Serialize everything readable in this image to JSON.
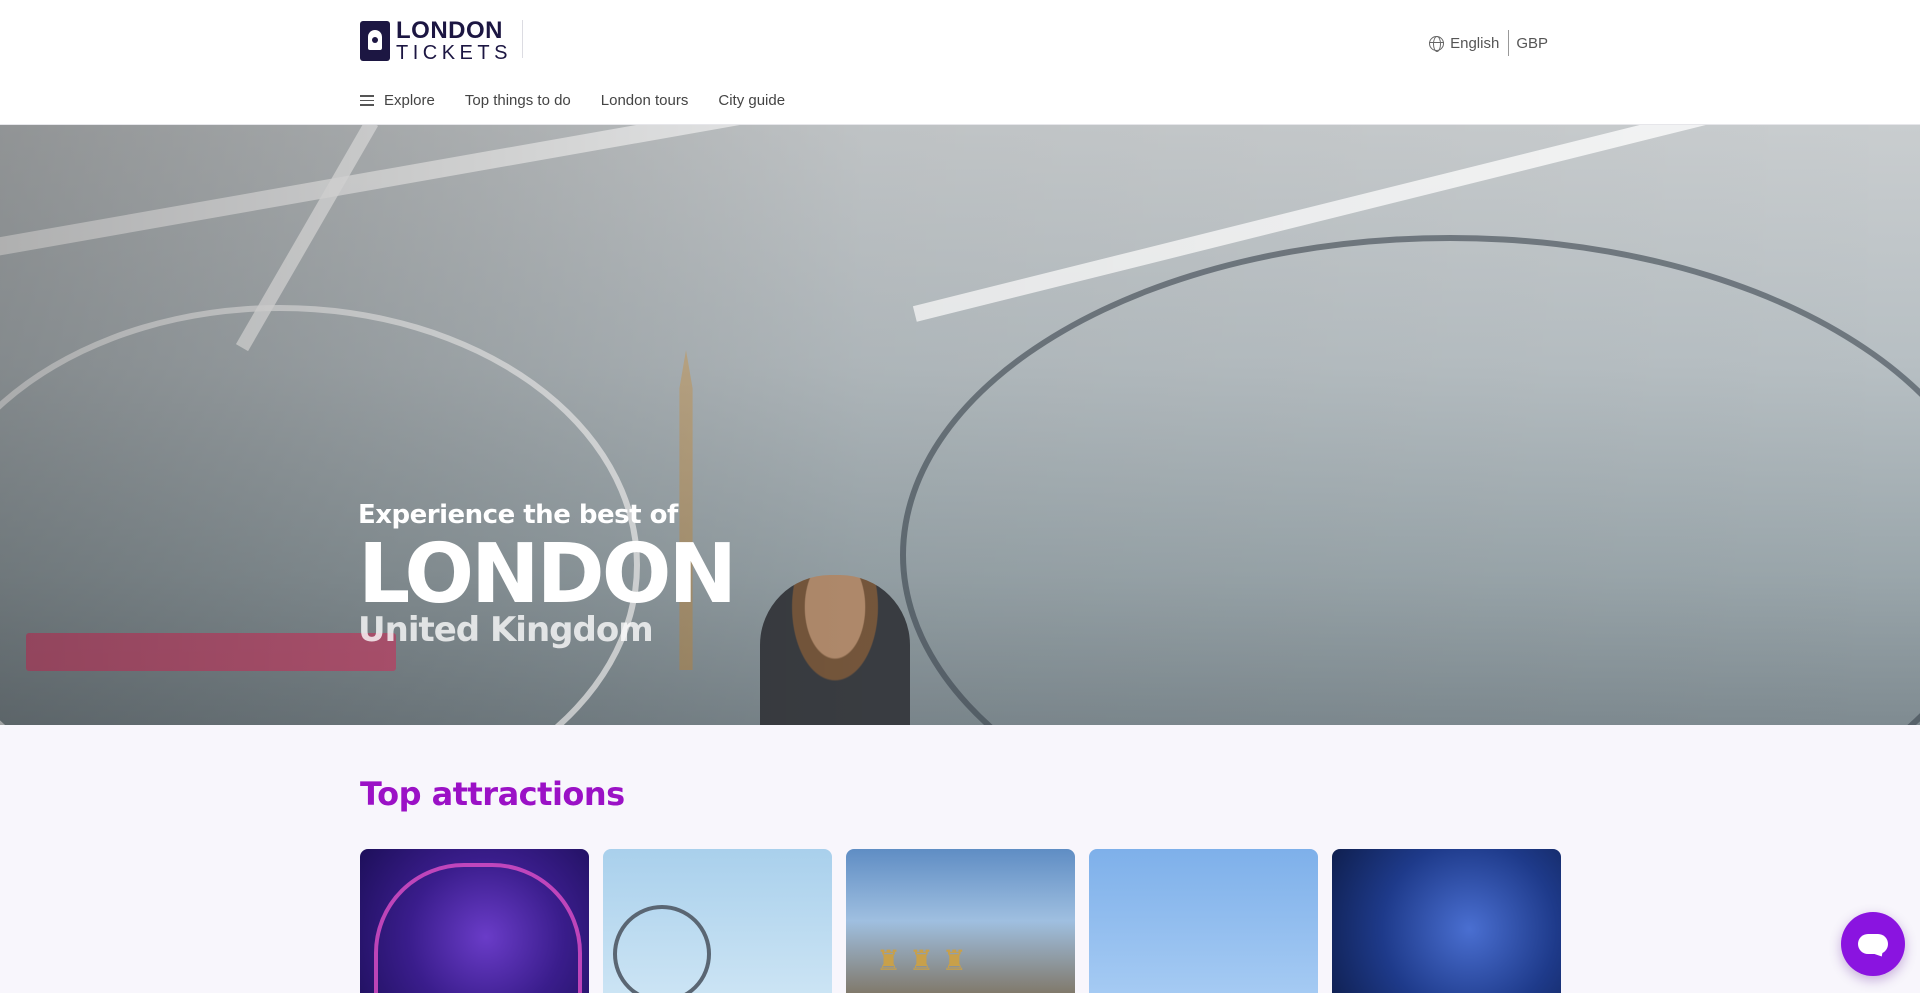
{
  "brand": {
    "logo_line1": "LONDON",
    "logo_line2": "TICKETS",
    "color_navy": "#1c1642",
    "color_accent": "#9b11c6"
  },
  "header": {
    "language": "English",
    "currency": "GBP",
    "globe_icon": "globe-icon"
  },
  "nav": {
    "explore": "Explore",
    "items": [
      "Top things to do",
      "London tours",
      "City guide"
    ]
  },
  "hero": {
    "kicker": "Experience the best of",
    "city": "LONDON",
    "country": "United Kingdom"
  },
  "attractions": {
    "title": "Top attractions",
    "cards": [
      "card-1",
      "card-2",
      "card-3",
      "card-4",
      "card-5"
    ]
  },
  "chat": {
    "icon": "chat-icon"
  }
}
